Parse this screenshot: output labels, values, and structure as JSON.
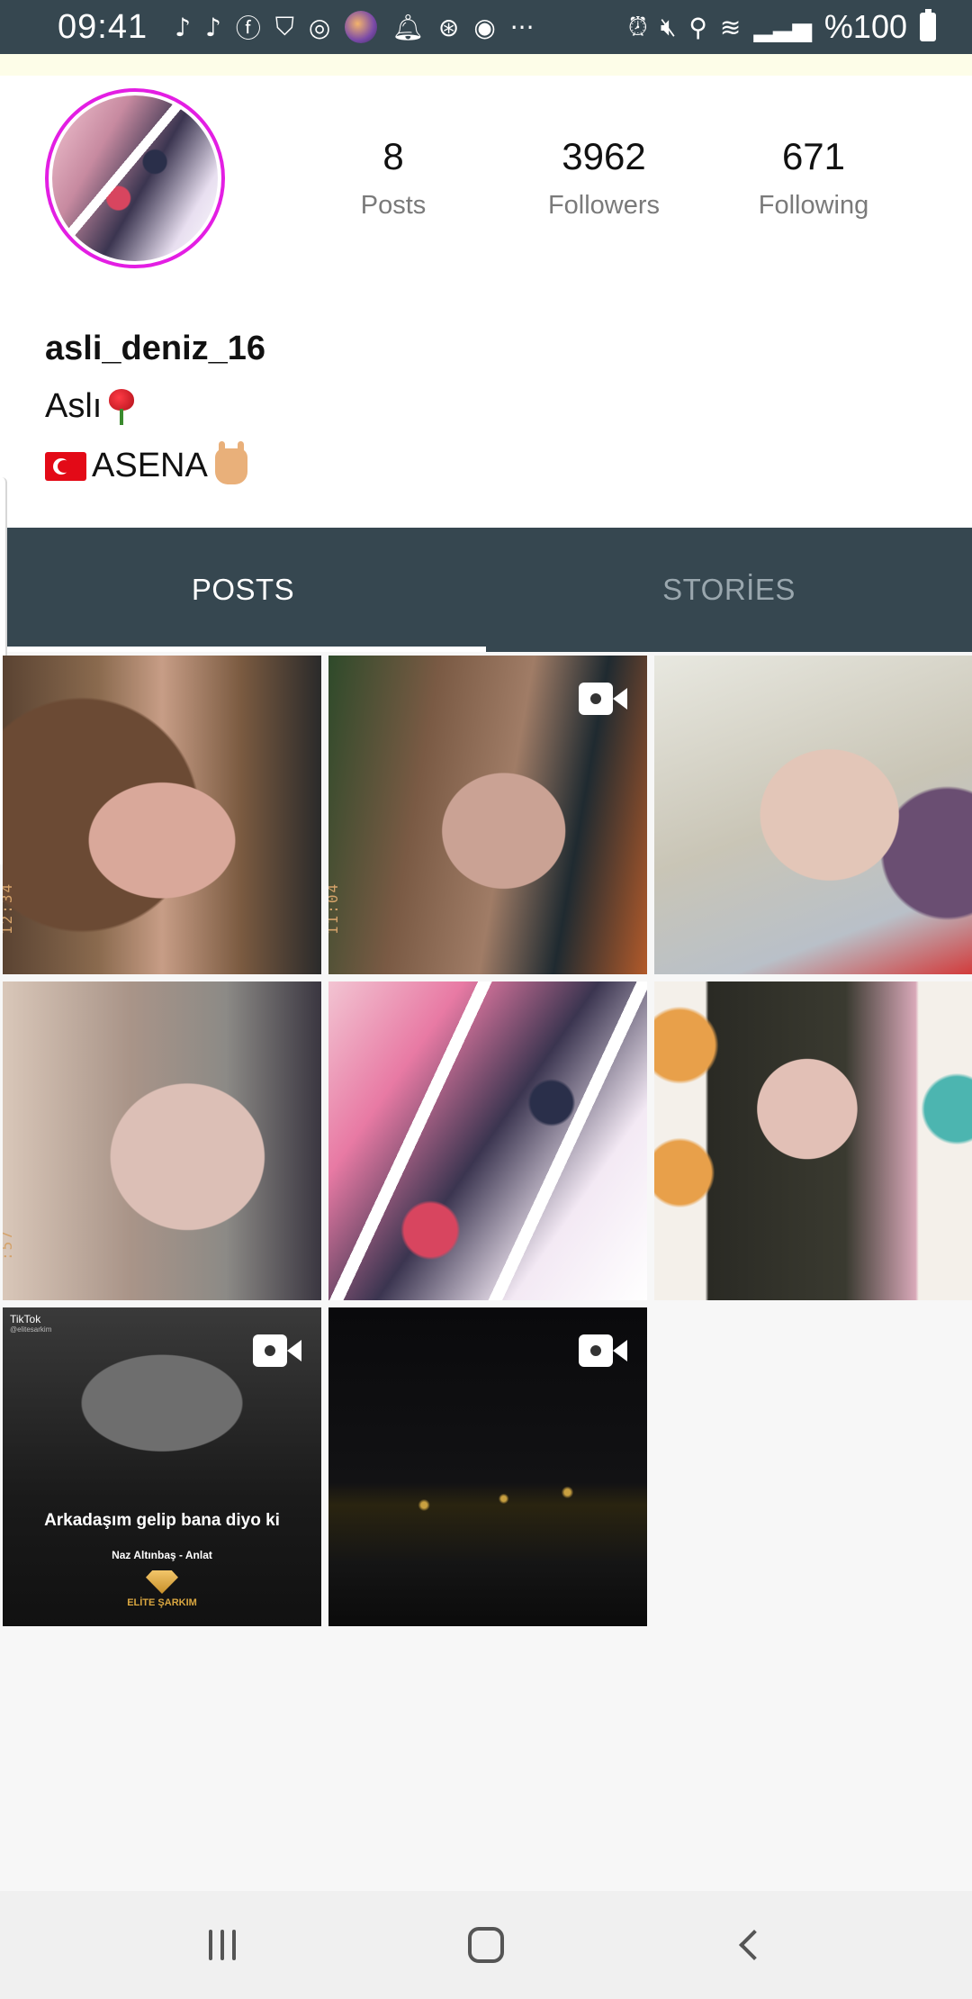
{
  "status_bar": {
    "time": "09:41",
    "battery": "%100",
    "left_icons": [
      "tiktok-icon",
      "tiktok-icon",
      "facebook-icon",
      "app-icon",
      "instagram-icon",
      "avatar-icon",
      "bell-icon",
      "app-icon",
      "app-icon",
      "more-icon"
    ],
    "right_icons": [
      "alarm-icon",
      "mute-icon",
      "location-icon",
      "wifi-icon",
      "signal-icon",
      "battery-icon"
    ]
  },
  "profile": {
    "username": "asli_deniz_16",
    "bio_line1": "Aslı",
    "bio_line2": "ASENA",
    "stats": {
      "posts_value": "8",
      "posts_label": "Posts",
      "followers_value": "3962",
      "followers_label": "Followers",
      "following_value": "671",
      "following_label": "Following"
    }
  },
  "tabs": {
    "posts": "POSTS",
    "stories": "STORİES",
    "active": "posts"
  },
  "posts": [
    {
      "type": "photo",
      "stamp": "12:34"
    },
    {
      "type": "video",
      "stamp": "11:04"
    },
    {
      "type": "photo"
    },
    {
      "type": "photo",
      "stamp": ":57"
    },
    {
      "type": "photo"
    },
    {
      "type": "photo"
    },
    {
      "type": "video",
      "overlay_app": "TikTok",
      "overlay_handle": "@elitesarkim",
      "caption": "Arkadaşım gelip bana diyo ki",
      "subcaption": "Naz Altınbaş - Anlat",
      "brand": "ELİTE ŞARKIM"
    },
    {
      "type": "video"
    }
  ],
  "colors": {
    "header_bg": "#364750",
    "avatar_ring": "#e31ee3",
    "tab_inactive": "#9aa7ae",
    "tab_active": "#ffffff"
  }
}
